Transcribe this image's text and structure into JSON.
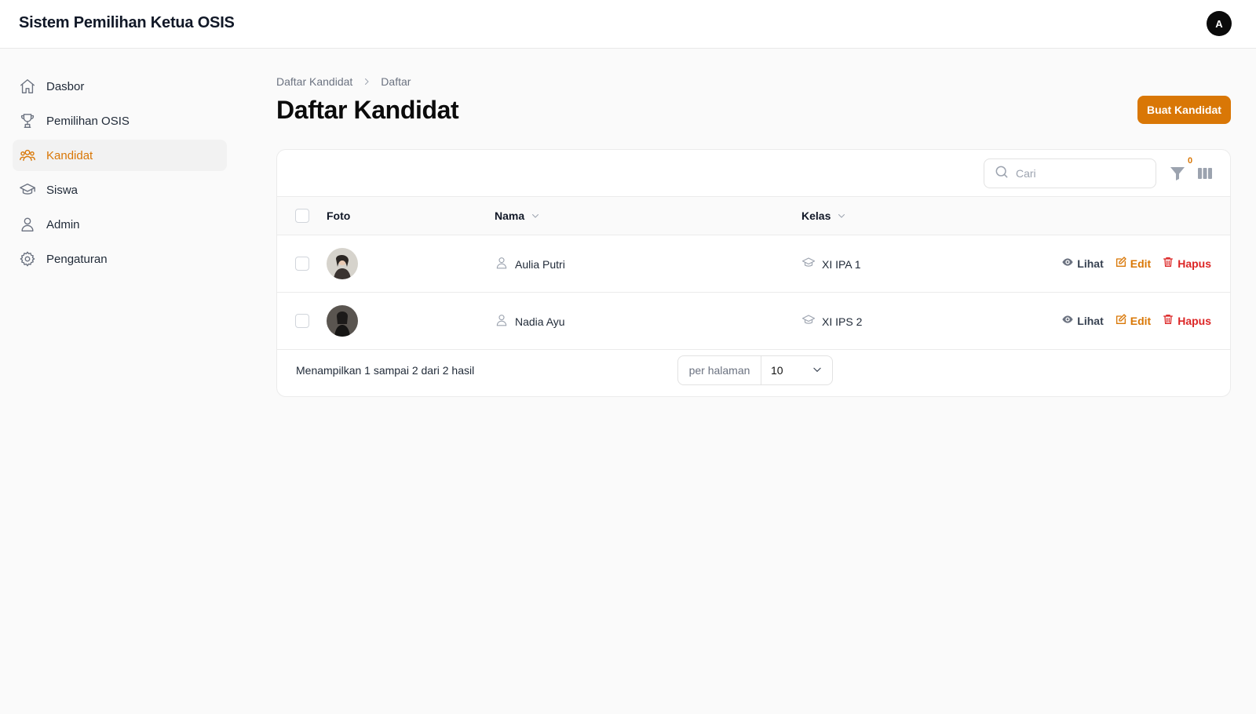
{
  "app": {
    "title": "Sistem Pemilihan Ketua OSIS",
    "avatar_initial": "A"
  },
  "sidebar": {
    "items": [
      {
        "label": "Dasbor",
        "icon": "home-icon",
        "active": false
      },
      {
        "label": "Pemilihan OSIS",
        "icon": "trophy-icon",
        "active": false
      },
      {
        "label": "Kandidat",
        "icon": "users-icon",
        "active": true
      },
      {
        "label": "Siswa",
        "icon": "graduation-cap-icon",
        "active": false
      },
      {
        "label": "Admin",
        "icon": "user-icon",
        "active": false
      },
      {
        "label": "Pengaturan",
        "icon": "gear-icon",
        "active": false
      }
    ]
  },
  "breadcrumb": {
    "parent": "Daftar Kandidat",
    "current": "Daftar"
  },
  "page": {
    "title": "Daftar Kandidat",
    "create_button": "Buat Kandidat"
  },
  "table": {
    "search_placeholder": "Cari",
    "filter_count": "0",
    "columns": {
      "photo": "Foto",
      "name": "Nama",
      "class": "Kelas"
    },
    "rows": [
      {
        "name": "Aulia Putri",
        "class": "XI IPA 1",
        "actions": {
          "view": "Lihat",
          "edit": "Edit",
          "delete": "Hapus"
        }
      },
      {
        "name": "Nadia Ayu",
        "class": "XI IPS 2",
        "actions": {
          "view": "Lihat",
          "edit": "Edit",
          "delete": "Hapus"
        }
      }
    ],
    "footer": {
      "summary": "Menampilkan 1 sampai 2 dari 2 hasil",
      "per_page_label": "per halaman",
      "per_page_value": "10"
    }
  },
  "colors": {
    "accent": "#d97706",
    "danger": "#dc2626"
  }
}
